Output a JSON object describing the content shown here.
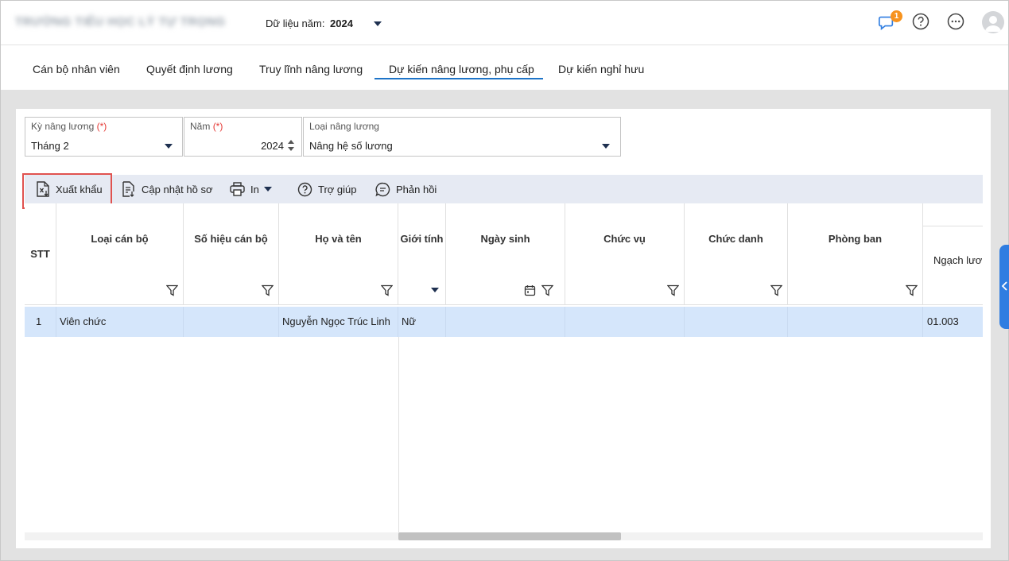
{
  "header": {
    "school_name": "TRƯỜNG TIỂU HỌC LÝ TỰ TRỌNG",
    "year_label": "Dữ liệu năm:",
    "year_value": "2024",
    "notification_count": "1"
  },
  "tabs": [
    {
      "label": "Cán bộ nhân viên"
    },
    {
      "label": "Quyết định lương"
    },
    {
      "label": "Truy lĩnh nâng lương"
    },
    {
      "label": "Dự kiến nâng lương, phụ cấp"
    },
    {
      "label": "Dự kiến nghỉ hưu"
    }
  ],
  "filters": {
    "period": {
      "label": "Kỳ nâng lương",
      "required": "(*)",
      "value": "Tháng 2"
    },
    "year": {
      "label": "Năm",
      "required": "(*)",
      "value": "2024"
    },
    "type": {
      "label": "Loại nâng lương",
      "value": "Nâng hệ số lương"
    }
  },
  "toolbar": {
    "export": "Xuất khẩu",
    "update": "Cập nhật hồ sơ",
    "print": "In",
    "help": "Trợ giúp",
    "feedback": "Phản hồi"
  },
  "grid": {
    "columns": [
      "STT",
      "Loại cán bộ",
      "Số hiệu cán bộ",
      "Họ và tên",
      "Giới tính",
      "Ngày sinh",
      "Chức vụ",
      "Chức danh",
      "Phòng ban",
      "Ngạch lươ"
    ],
    "rows": [
      {
        "stt": "1",
        "loai": "Viên chức",
        "sohieu": "",
        "hoten": "Nguyễn Ngọc Trúc Linh",
        "gioitinh": "Nữ",
        "ngaysinh": "",
        "chucvu": "",
        "chucdanh": "",
        "phongban": "",
        "ngach": "01.003"
      }
    ]
  },
  "colors": {
    "accent": "#1e74c8",
    "badge": "#f7931e",
    "selected_row": "#d5e6fb",
    "highlight_box": "#e0524f"
  }
}
